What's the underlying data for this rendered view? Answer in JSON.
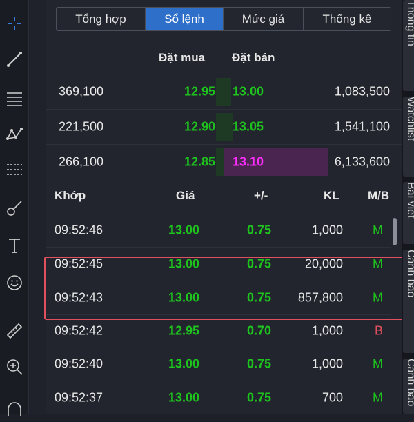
{
  "tabs": [
    "Tổng hợp",
    "Sổ lệnh",
    "Mức giá",
    "Thống kê"
  ],
  "active_tab": 1,
  "orderbook": {
    "bid_header": "Đặt mua",
    "ask_header": "Đặt bán",
    "rows": [
      {
        "bid_vol": "369,100",
        "bid": "12.95",
        "ask": "13.00",
        "ask_vol": "1,083,500",
        "ask_color": "#1ec31e"
      },
      {
        "bid_vol": "221,500",
        "bid": "12.90",
        "ask": "13.05",
        "ask_vol": "1,541,100",
        "ask_color": "#1ec31e"
      },
      {
        "bid_vol": "266,100",
        "bid": "12.85",
        "ask": "13.10",
        "ask_vol": "6,133,600",
        "ask_color": "#ff2dff"
      }
    ]
  },
  "trades": {
    "headers": {
      "time": "Khớp",
      "price": "Giá",
      "change": "+/-",
      "volume": "KL",
      "side": "M/B"
    },
    "rows": [
      {
        "time": "09:52:46",
        "price": "13.00",
        "change": "0.75",
        "volume": "1,000",
        "side": "M"
      },
      {
        "time": "09:52:45",
        "price": "13.00",
        "change": "0.75",
        "volume": "20,000",
        "side": "M"
      },
      {
        "time": "09:52:43",
        "price": "13.00",
        "change": "0.75",
        "volume": "857,800",
        "side": "M"
      },
      {
        "time": "09:52:42",
        "price": "12.95",
        "change": "0.70",
        "volume": "1,000",
        "side": "B"
      },
      {
        "time": "09:52:40",
        "price": "13.00",
        "change": "0.75",
        "volume": "1,000",
        "side": "M"
      },
      {
        "time": "09:52:37",
        "price": "13.00",
        "change": "0.75",
        "volume": "700",
        "side": "M"
      }
    ]
  },
  "side_tabs": [
    "Thông tin",
    "Watchlist",
    "Bài viết",
    "Cảnh báo",
    "Cảnh báo"
  ],
  "colors": {
    "up": "#1ec31e",
    "ceiling": "#ff2dff",
    "buy": "#1ec31e",
    "sell": "#e0505e",
    "accent": "#2d6fc9",
    "highlight": "#e0505e"
  },
  "toolbar_icons": [
    "crosshair-icon",
    "trendline-icon",
    "horizontal-lines-icon",
    "pattern-icon",
    "fib-icon",
    "brush-icon",
    "text-icon",
    "emoji-icon",
    "ruler-icon",
    "zoom-in-icon",
    "magnet-icon"
  ]
}
